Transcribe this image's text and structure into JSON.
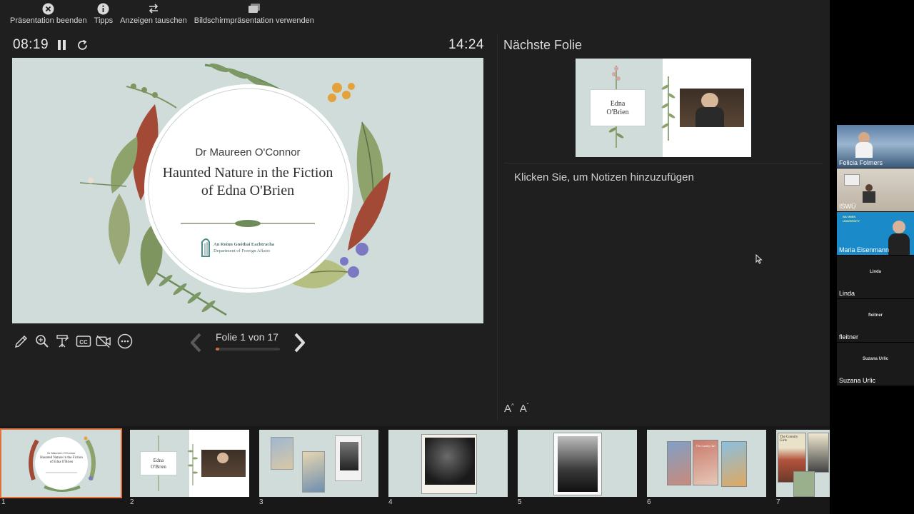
{
  "toolbar": {
    "end": "Präsentation beenden",
    "tips": "Tipps",
    "swap": "Anzeigen tauschen",
    "use_slideshow": "Bildschirmpräsentation verwenden"
  },
  "timer": {
    "elapsed": "08:19",
    "clock": "14:24"
  },
  "current_slide": {
    "speaker": "Dr Maureen O'Connor",
    "title_line1": "Haunted Nature in the Fiction",
    "title_line2": "of Edna O'Brien",
    "logo_line1": "An Roinn Gnóthaí Eachtracha",
    "logo_line2": "Department of Foreign Affairs"
  },
  "navigation": {
    "counter": "Folie 1 von 17",
    "progress": 0.0588
  },
  "next_slide": {
    "label": "Nächste Folie",
    "box_line1": "Edna",
    "box_line2": "O'Brien"
  },
  "notes": {
    "placeholder": "Klicken Sie, um Notizen hinzuzufügen",
    "font_increase": "A",
    "font_decrease": "A"
  },
  "thumbnails": [
    {
      "number": "1",
      "line1": "Dr Maureen O'Connor",
      "line2": "Haunted Nature in the Fiction",
      "line3": "of Edna O'Brien"
    },
    {
      "number": "2",
      "line1": "Edna",
      "line2": "O'Brien"
    },
    {
      "number": "3"
    },
    {
      "number": "4"
    },
    {
      "number": "5"
    },
    {
      "number": "6",
      "book_title": "The Lonely Girl"
    },
    {
      "number": "7",
      "book_title": "The Country Girls"
    }
  ],
  "participants": [
    {
      "name": "Felicia Folmers"
    },
    {
      "name": "ISWÜ"
    },
    {
      "name": "Maria Eisenmann",
      "banner": "WU WIEN UNIVERSITY"
    },
    {
      "name": "Linda",
      "center_label": "Linda"
    },
    {
      "name": "fleitner",
      "center_label": "fleitner"
    },
    {
      "name": "Suzana Urlic",
      "center_label": "Suzana Urlic"
    }
  ],
  "colors": {
    "accent": "#e0703c",
    "progress": "#c76a3a",
    "slide_bg": "#cfdcda",
    "title_text": "#333333"
  }
}
